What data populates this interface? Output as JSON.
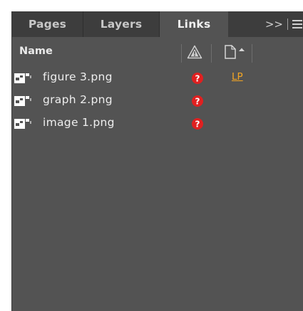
{
  "tabs": [
    {
      "label": "Pages",
      "active": false
    },
    {
      "label": "Layers",
      "active": false
    },
    {
      "label": "Links",
      "active": true
    }
  ],
  "tab_overflow_label": ">>",
  "columns": {
    "name_label": "Name",
    "status_icon": "warning-triangle-icon",
    "page_icon": "page-sort-icon"
  },
  "links": [
    {
      "name": "figure 3.png",
      "status": "missing",
      "page": "LP"
    },
    {
      "name": "graph 2.png",
      "status": "missing",
      "page": ""
    },
    {
      "name": "image 1.png",
      "status": "missing",
      "page": ""
    }
  ],
  "colors": {
    "panel_bg": "#535353",
    "tabbar_bg": "#3d3d3d",
    "missing_badge": "#e02020",
    "page_link": "#f5a623"
  }
}
